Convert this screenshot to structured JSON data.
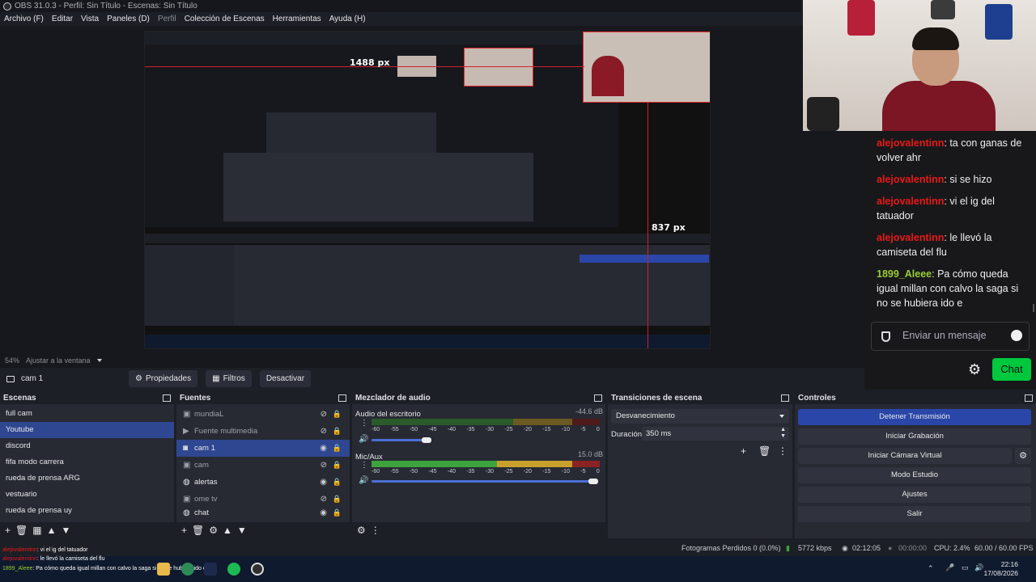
{
  "window": {
    "title": "OBS 31.0.3 - Perfil: Sin Título - Escenas: Sin Título"
  },
  "menu": [
    "Archivo (F)",
    "Editar",
    "Vista",
    "Paneles (D)",
    "Perfil",
    "Colección de Escenas",
    "Herramientas",
    "Ayuda (H)"
  ],
  "preview": {
    "width_label": "1488 px",
    "height_label": "837 px",
    "zoom": "54%",
    "fit_label": "Ajustar a la ventana"
  },
  "source_toolbar": {
    "selected": "cam 1",
    "properties": "Propiedades",
    "filters": "Filtros",
    "disable": "Desactivar"
  },
  "scenes": {
    "title": "Escenas",
    "items": [
      "full cam",
      "Youtube",
      "discord",
      "fifa modo carrera",
      "rueda de prensa ARG",
      "vestuario",
      "rueda de prensa uy"
    ],
    "active": "Youtube"
  },
  "sources": {
    "title": "Fuentes",
    "items": [
      {
        "name": "mundiaL",
        "icon": "image-icon",
        "visible": false
      },
      {
        "name": "Fuente multimedia",
        "icon": "play-icon",
        "visible": false
      },
      {
        "name": "cam 1",
        "icon": "camera-icon",
        "visible": true
      },
      {
        "name": "cam",
        "icon": "image-icon",
        "visible": false
      },
      {
        "name": "alertas",
        "icon": "globe-icon",
        "visible": true
      },
      {
        "name": "ome tv",
        "icon": "image-icon",
        "visible": false
      },
      {
        "name": "chat",
        "icon": "globe-icon",
        "visible": true
      }
    ]
  },
  "mixer": {
    "title": "Mezclador de audio",
    "scale": [
      "-60",
      "-55",
      "-50",
      "-45",
      "-40",
      "-35",
      "-30",
      "-25",
      "-20",
      "-15",
      "-10",
      "-5",
      "0"
    ],
    "tracks": [
      {
        "name": "Audio del escritorio",
        "db": "-44.6 dB",
        "volume": 0.24
      },
      {
        "name": "Mic/Aux",
        "db": "15.0 dB",
        "volume": 0.97
      }
    ]
  },
  "transitions": {
    "title": "Transiciones de escena",
    "selected": "Desvanecimiento",
    "duration_label": "Duración",
    "duration": "350 ms"
  },
  "controls": {
    "title": "Controles",
    "buttons": [
      "Detener Transmisión",
      "Iniciar Grabación",
      "Iniciar Cámara Virtual",
      "Modo Estudio",
      "Ajustes",
      "Salir"
    ]
  },
  "chat": {
    "messages": [
      {
        "user": "alejovalentinn",
        "text": "ta con ganas de volver ahr",
        "color": "#e91916"
      },
      {
        "user": "alejovalentinn",
        "text": "si se hizo",
        "color": "#e91916"
      },
      {
        "user": "alejovalentinn",
        "text": "vi el ig del tatuador",
        "color": "#e91916"
      },
      {
        "user": "alejovalentinn",
        "text": "le llevó la camiseta del flu",
        "color": "#e91916"
      },
      {
        "user": "1899_Aleee",
        "text": "Pa cómo queda igual millan con calvo la saga si no se hubiera ido e",
        "color": "#9acd32"
      }
    ],
    "placeholder": "Enviar un mensaje",
    "button": "Chat"
  },
  "status": {
    "dropped": "Fotogramas Perdidos 0 (0.0%)",
    "kbps": "5772 kbps",
    "stream_time": "02:12:05",
    "rec_time": "00:00:00",
    "cpu": "CPU: 2.4%",
    "fps": "60.00 / 60.00 FPS"
  },
  "overlay_chat": [
    {
      "user": "alejovalentinn",
      "text": ": vi el ig del tatuador"
    },
    {
      "user": "alejovalentinn",
      "text": ": le llevó la camiseta del flu"
    },
    {
      "user": "1899_Aleee",
      "text": ": Pa cómo queda igual millan con calvo la saga si no se hubiera ido e"
    }
  ],
  "taskbar": {
    "time": "22:16",
    "date": "17/08/2026"
  }
}
